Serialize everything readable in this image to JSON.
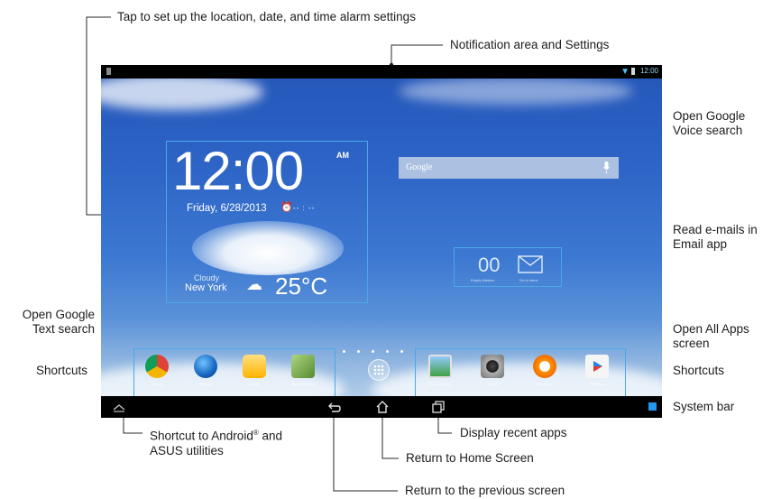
{
  "annotations": {
    "tap_location_date_time": "Tap to set up the location, date, and time alarm settings",
    "notification_area": "Notification area and Settings",
    "voice_search_line1": "Open Google",
    "voice_search_line2": "Voice search",
    "email_line1": "Read e-mails in",
    "email_line2": "Email app",
    "text_search_line1": "Open Google",
    "text_search_line2": "Text search",
    "all_apps_line1": "Open All Apps",
    "all_apps_line2": "screen",
    "shortcuts_left": "Shortcuts",
    "shortcuts_right": "Shortcuts",
    "system_bar": "System bar",
    "android_shortcut_line1_a": "Shortcut to Android",
    "android_shortcut_line1_reg": "®",
    "android_shortcut_line1_b": " and",
    "android_shortcut_line2": "ASUS utilities",
    "recent_apps": "Display recent apps",
    "home_screen": "Return to Home Screen",
    "previous_screen": "Return to the previous screen"
  },
  "screen": {
    "status_time": "12:00",
    "clock": {
      "time": "12:00",
      "ampm": "AM",
      "date": "Friday, 6/28/2013",
      "alarm": "-- : --"
    },
    "weather": {
      "condition": "Cloudy",
      "city": "New York",
      "temperature": "25°C"
    },
    "search": {
      "logo": "Google"
    },
    "email": {
      "count": "00",
      "count_label": "Empty Mailbox",
      "inbox_label": "Go to inbox"
    },
    "dock_left": [
      {
        "label": "Chrome",
        "icon": "chrome-icon"
      },
      {
        "label": "Browser",
        "icon": "browser-globe-icon"
      },
      {
        "label": "Email",
        "icon": "email-app-icon"
      },
      {
        "label": "Asus Launcher",
        "icon": "asus-notes-icon"
      }
    ],
    "dock_right": [
      {
        "label": "ASUS Gallery",
        "icon": "gallery-icon"
      },
      {
        "label": "Camera",
        "icon": "camera-icon"
      },
      {
        "label": "Play Music",
        "icon": "headphones-icon"
      },
      {
        "label": "Play Store",
        "icon": "play-store-icon"
      }
    ]
  },
  "colors": {
    "highlight_border": "#4aa8e8",
    "wallpaper_top": "#2456b8",
    "system_bar": "#000000"
  }
}
